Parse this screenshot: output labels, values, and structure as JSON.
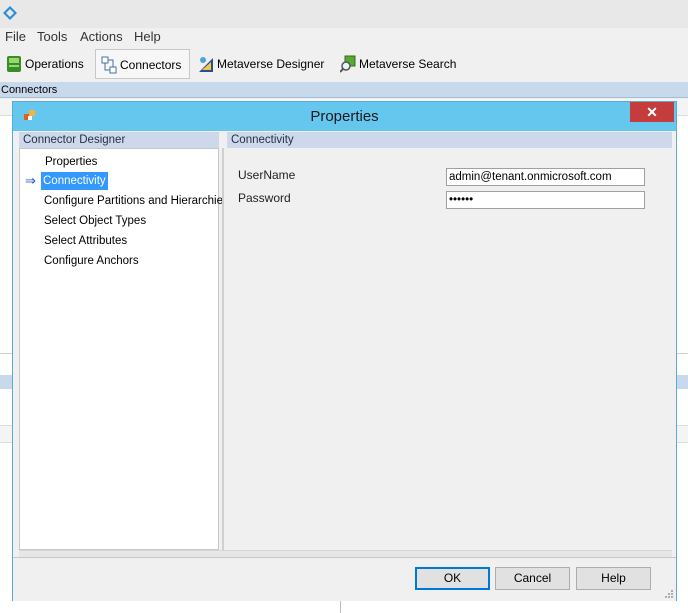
{
  "app": {
    "menus": [
      "File",
      "Tools",
      "Actions",
      "Help"
    ],
    "toolbar": [
      {
        "label": "Operations",
        "icon": "operations-icon"
      },
      {
        "label": "Connectors",
        "icon": "connectors-icon",
        "active": true
      },
      {
        "label": "Metaverse Designer",
        "icon": "metaverse-designer-icon"
      },
      {
        "label": "Metaverse Search",
        "icon": "metaverse-search-icon"
      }
    ],
    "section_title": "Connectors"
  },
  "dialog": {
    "title": "Properties",
    "close_label": "✕",
    "left_header": "Connector Designer",
    "nav_items": [
      "Properties",
      "Connectivity",
      "Configure Partitions and Hierarchies",
      "Select Object Types",
      "Select Attributes",
      "Configure Anchors"
    ],
    "selected_nav": "Connectivity",
    "nav_arrow": "⇒",
    "right_header": "Connectivity",
    "fields": {
      "username_label": "UserName",
      "username_value": "admin@tenant.onmicrosoft.com",
      "password_label": "Password",
      "password_value": "••••••"
    },
    "buttons": {
      "ok": "OK",
      "cancel": "Cancel",
      "help": "Help"
    }
  },
  "colors": {
    "title_bar": "#65c6ee",
    "close_button": "#c43c3c",
    "pane_header": "#cdd9ea",
    "selection": "#3399ff"
  }
}
